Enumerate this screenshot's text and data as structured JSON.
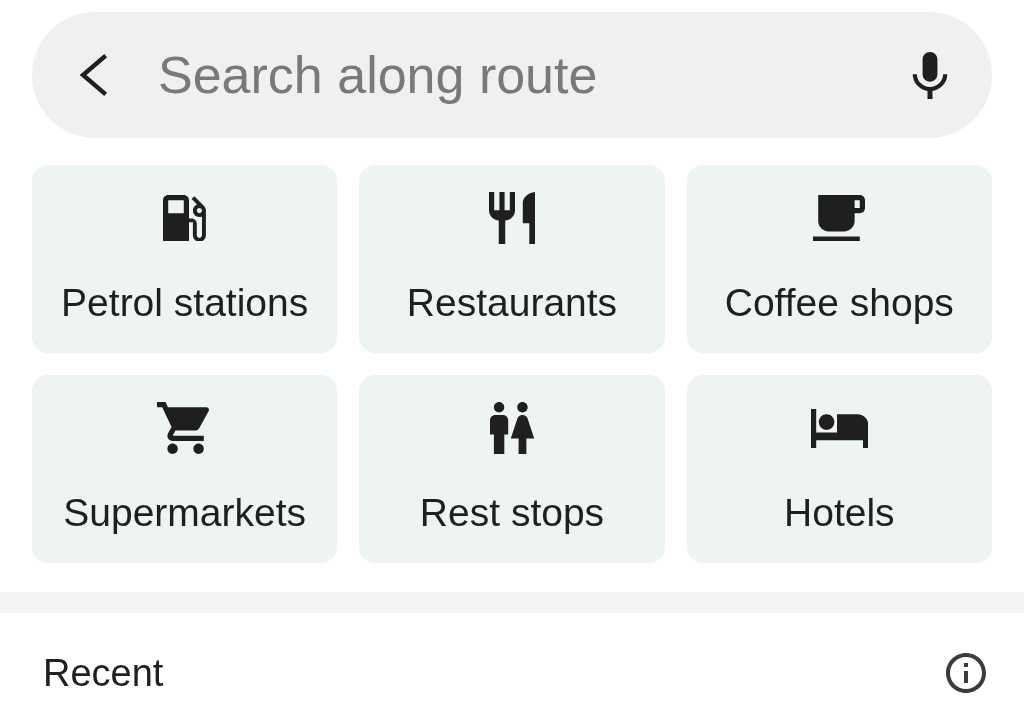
{
  "search": {
    "placeholder": "Search along route"
  },
  "categories": [
    {
      "label": "Petrol stations"
    },
    {
      "label": "Restaurants"
    },
    {
      "label": "Coffee shops"
    },
    {
      "label": "Supermarkets"
    },
    {
      "label": "Rest stops"
    },
    {
      "label": "Hotels"
    }
  ],
  "recent": {
    "title": "Recent"
  }
}
